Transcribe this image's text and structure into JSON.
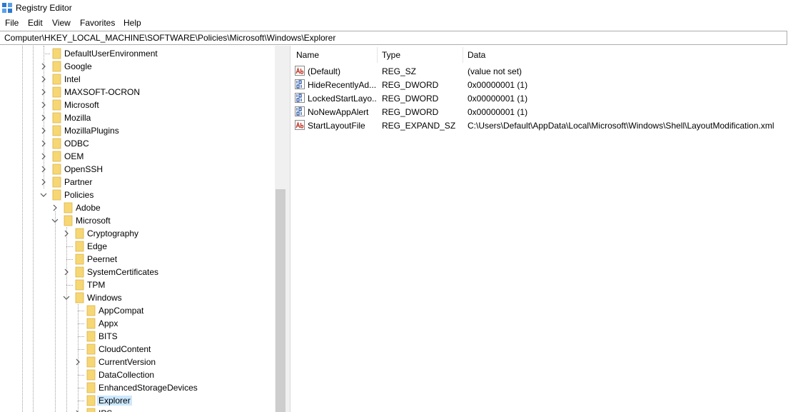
{
  "window": {
    "title": "Registry Editor"
  },
  "menu": [
    "File",
    "Edit",
    "View",
    "Favorites",
    "Help"
  ],
  "address": "Computer\\HKEY_LOCAL_MACHINE\\SOFTWARE\\Policies\\Microsoft\\Windows\\Explorer",
  "tree": [
    {
      "label": "DefaultUserEnvironment",
      "depth": 0,
      "expander": "none"
    },
    {
      "label": "Google",
      "depth": 0,
      "expander": "collapsed"
    },
    {
      "label": "Intel",
      "depth": 0,
      "expander": "collapsed"
    },
    {
      "label": "MAXSOFT-OCRON",
      "depth": 0,
      "expander": "collapsed"
    },
    {
      "label": "Microsoft",
      "depth": 0,
      "expander": "collapsed"
    },
    {
      "label": "Mozilla",
      "depth": 0,
      "expander": "collapsed"
    },
    {
      "label": "MozillaPlugins",
      "depth": 0,
      "expander": "collapsed"
    },
    {
      "label": "ODBC",
      "depth": 0,
      "expander": "collapsed"
    },
    {
      "label": "OEM",
      "depth": 0,
      "expander": "collapsed"
    },
    {
      "label": "OpenSSH",
      "depth": 0,
      "expander": "collapsed"
    },
    {
      "label": "Partner",
      "depth": 0,
      "expander": "collapsed"
    },
    {
      "label": "Policies",
      "depth": 0,
      "expander": "expanded"
    },
    {
      "label": "Adobe",
      "depth": 1,
      "expander": "collapsed"
    },
    {
      "label": "Microsoft",
      "depth": 1,
      "expander": "expanded"
    },
    {
      "label": "Cryptography",
      "depth": 2,
      "expander": "collapsed"
    },
    {
      "label": "Edge",
      "depth": 2,
      "expander": "none"
    },
    {
      "label": "Peernet",
      "depth": 2,
      "expander": "none"
    },
    {
      "label": "SystemCertificates",
      "depth": 2,
      "expander": "collapsed"
    },
    {
      "label": "TPM",
      "depth": 2,
      "expander": "none"
    },
    {
      "label": "Windows",
      "depth": 2,
      "expander": "expanded"
    },
    {
      "label": "AppCompat",
      "depth": 3,
      "expander": "none"
    },
    {
      "label": "Appx",
      "depth": 3,
      "expander": "none"
    },
    {
      "label": "BITS",
      "depth": 3,
      "expander": "none"
    },
    {
      "label": "CloudContent",
      "depth": 3,
      "expander": "none"
    },
    {
      "label": "CurrentVersion",
      "depth": 3,
      "expander": "collapsed"
    },
    {
      "label": "DataCollection",
      "depth": 3,
      "expander": "none"
    },
    {
      "label": "EnhancedStorageDevices",
      "depth": 3,
      "expander": "none"
    },
    {
      "label": "Explorer",
      "depth": 3,
      "expander": "none",
      "selected": true
    },
    {
      "label": "IPS",
      "depth": 3,
      "expander": "collapsed"
    }
  ],
  "list": {
    "columns": [
      "Name",
      "Type",
      "Data"
    ],
    "rows": [
      {
        "icon": "string-value-icon",
        "name": "(Default)",
        "type": "REG_SZ",
        "data": "(value not set)"
      },
      {
        "icon": "binary-value-icon",
        "name": "HideRecentlyAd...",
        "type": "REG_DWORD",
        "data": "0x00000001 (1)"
      },
      {
        "icon": "binary-value-icon",
        "name": "LockedStartLayo...",
        "type": "REG_DWORD",
        "data": "0x00000001 (1)"
      },
      {
        "icon": "binary-value-icon",
        "name": "NoNewAppAlert",
        "type": "REG_DWORD",
        "data": "0x00000001 (1)"
      },
      {
        "icon": "string-value-icon",
        "name": "StartLayoutFile",
        "type": "REG_EXPAND_SZ",
        "data": "C:\\Users\\Default\\AppData\\Local\\Microsoft\\Windows\\Shell\\LayoutModification.xml"
      }
    ]
  },
  "colors": {
    "folder": "#f7d774",
    "selection": "#cce8ff",
    "string-icon": "#c0392b",
    "binary-icon": "#1f4e9e"
  }
}
